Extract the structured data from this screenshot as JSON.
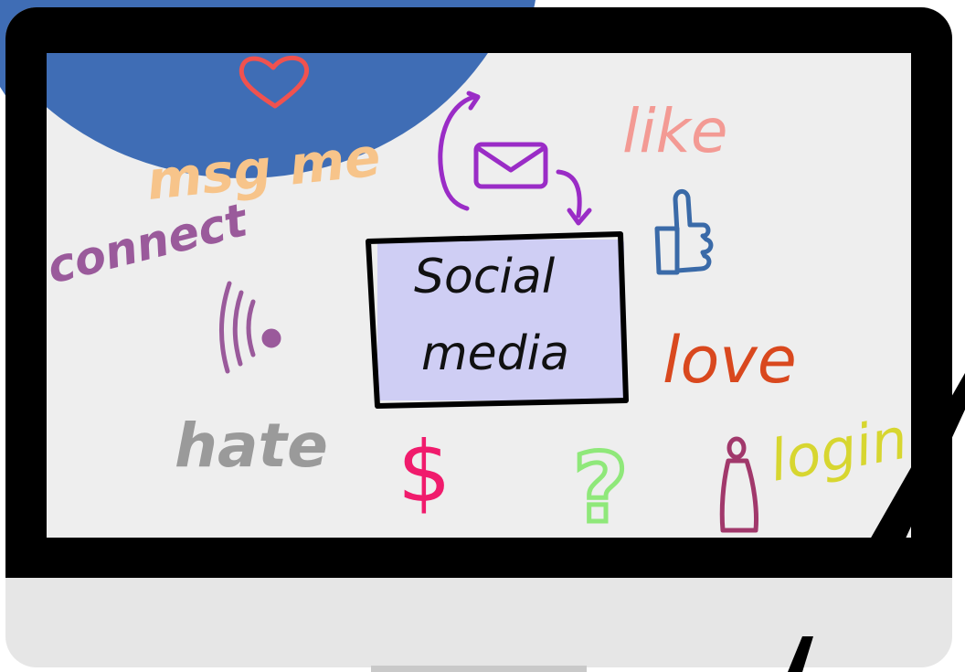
{
  "doodle": {
    "center_line1": "Social",
    "center_line2": "media",
    "words": {
      "msg_me": "msg me",
      "connect": "connect",
      "like": "like",
      "love": "love",
      "hate": "hate",
      "login": "login",
      "dollar": "$",
      "question": "?"
    }
  },
  "colors": {
    "background_circle": "#3f6db5",
    "bezel": "#000000",
    "screen": "#eeeeee",
    "chin": "#e6e6e6",
    "highlight": "#c9c8f5",
    "heart": "#f0524f",
    "msg_me": "#f7c48a",
    "connect": "#9a5a9b",
    "like": "#f39a94",
    "love": "#d9481e",
    "hate": "#9a9a9a",
    "login": "#d7d630",
    "dollar": "#f01b6c",
    "question": "#8fe87a",
    "envelope": "#9a2cc6",
    "thumb": "#3a6aa8",
    "person": "#a1386b"
  },
  "icons": [
    "heart-icon",
    "envelope-icon",
    "refresh-arrows-icon",
    "thumbs-up-icon",
    "wifi-signal-icon",
    "person-icon"
  ]
}
